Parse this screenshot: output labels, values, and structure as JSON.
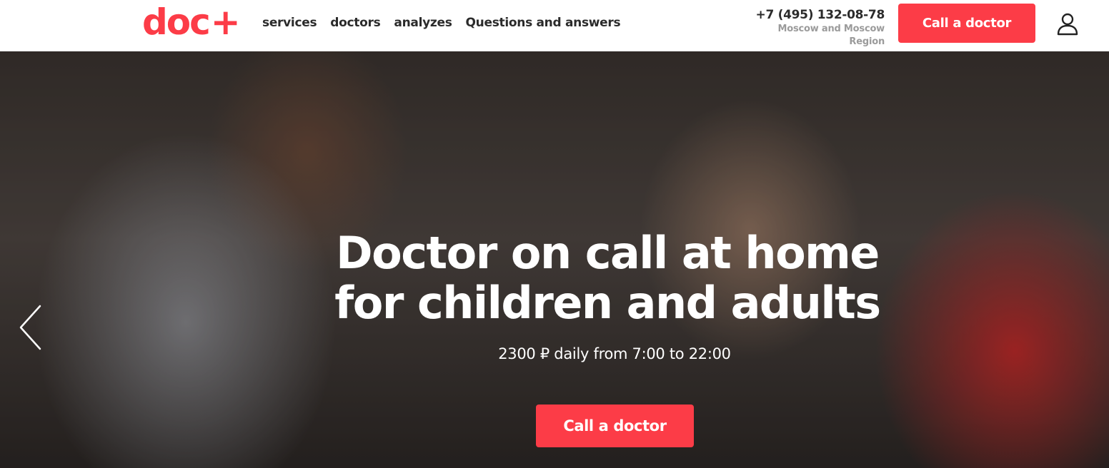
{
  "header": {
    "logo": {
      "text": "doc",
      "plus": "+"
    },
    "nav": [
      "services",
      "doctors",
      "analyzes",
      "Questions and answers"
    ],
    "phone": "+7 (495) 132-08-78",
    "region_line1": "Moscow and Moscow",
    "region_line2": "Region",
    "cta_label": "Call a doctor",
    "account_icon": "user-icon"
  },
  "hero": {
    "title_line1": "Doctor on call at home",
    "title_line2": "for children and adults",
    "subtitle": "2300 ₽ daily from 7:00 to 22:00",
    "cta_label": "Call a doctor",
    "prev_icon": "chevron-left-icon"
  },
  "colors": {
    "brand_red": "#fc3c47",
    "nav_text": "#2b2b2b",
    "region_text": "#9b9b9b",
    "hero_text": "#ffffff"
  }
}
